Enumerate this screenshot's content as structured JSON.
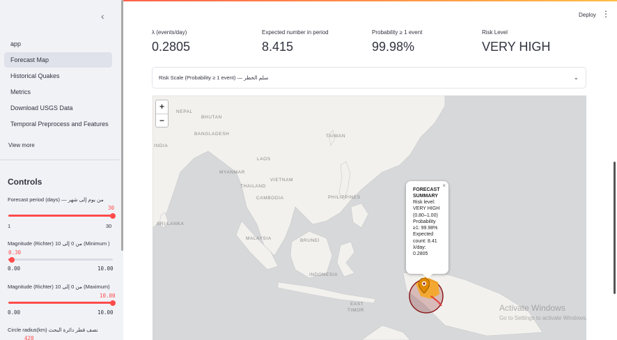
{
  "sidebar": {
    "collapse_icon": "chevron-left-icon",
    "nav": [
      {
        "label": "app",
        "active": false
      },
      {
        "label": "Forecast Map",
        "active": true
      },
      {
        "label": "Historical Quakes",
        "active": false
      },
      {
        "label": "Metrics",
        "active": false
      },
      {
        "label": "Download USGS Data",
        "active": false
      },
      {
        "label": "Temporal Preprocess and Features",
        "active": false
      }
    ],
    "view_more": "View more",
    "controls_title": "Controls",
    "forecast_period": {
      "label": "Forecast period (days) — من يوم إلى شهر",
      "value": "30",
      "min": "1",
      "max": "30",
      "fraction": 1.0
    },
    "magnitude_min": {
      "label": "Magnitude (Richter) من 0 إلى 10 (Minimum )",
      "value": "0.30",
      "min": "0.00",
      "max": "10.00",
      "fraction": 0.03
    },
    "magnitude_max": {
      "label": "Magnitude (Richter) من 0 إلى 10 (Maximum)",
      "value": "10.00",
      "min": "0.00",
      "max": "10.00",
      "fraction": 1.0
    },
    "circle_radius": {
      "label": "Circle radius(km) نصف قطر دائرة البحث",
      "value": "420"
    }
  },
  "header": {
    "deploy": "Deploy",
    "menu_icon": "kebab-menu-icon"
  },
  "metrics": [
    {
      "label": "λ (events/day)",
      "value": "0.2805"
    },
    {
      "label": "Expected number in period",
      "value": "8.415"
    },
    {
      "label": "Probability ≥ 1 event",
      "value": "99.98%"
    },
    {
      "label": "Risk Level",
      "value": "VERY HIGH"
    }
  ],
  "expander": {
    "label": "Risk Scale (Probability ≥ 1 event) — سلم الخطر"
  },
  "map": {
    "zoom_in": "+",
    "zoom_out": "−",
    "labels": {
      "nepal": "NEPAL",
      "bhutan": "BHUTAN",
      "bangladesh": "BANGLADESH",
      "india": "INDIA",
      "myanmar": "MYANMAR",
      "laos": "LAOS",
      "thailand": "THAILAND",
      "vietnam": "VIETNAM",
      "cambodia": "CAMBODIA",
      "taiwan": "TAIWAN",
      "philippines": "PHILIPPINES",
      "sri_lanka": "SRI LANKA",
      "malaysia": "MALAYSIA",
      "brunei": "BRUNEI",
      "indonesia": "INDONESIA",
      "east": "EAST",
      "timor": "TIMOR"
    },
    "popup": {
      "close": "×",
      "title_1": "FORECAST",
      "title_2": "SUMMARY",
      "lines": [
        "Risk level:",
        "VERY HIGH",
        "(0.80–1.00)",
        "Probability",
        "≥1: 99.98%",
        "Expected",
        "count: 8.41",
        "λ/day:",
        "0.2805"
      ]
    },
    "marker_icon": "map-pin-icon",
    "circle_color": "#8b1a1a",
    "highlight_color": "#f5a623"
  },
  "watermark": {
    "title": "Activate Windows",
    "subtitle": "Go to Settings to activate Windows."
  }
}
